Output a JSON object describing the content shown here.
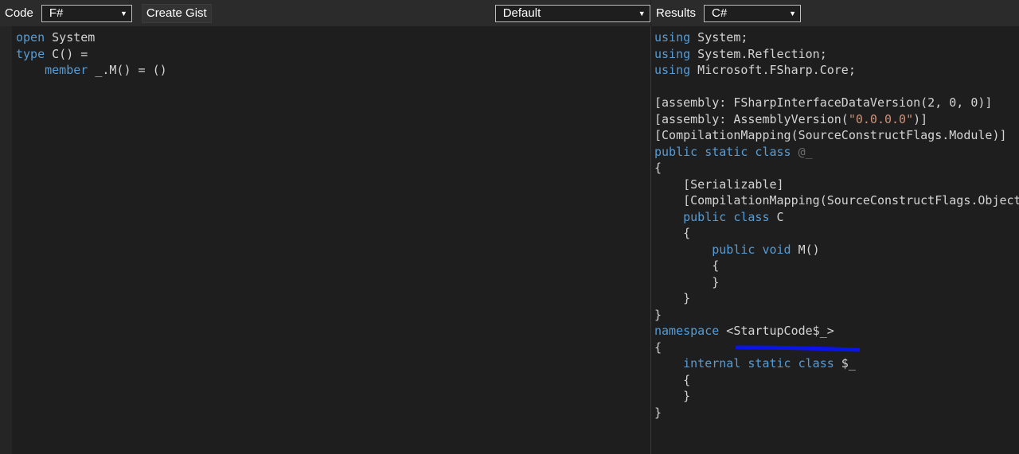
{
  "toolbar_left": {
    "code_label": "Code",
    "language_value": "F#",
    "create_gist_label": "Create Gist",
    "mode_value": "Default"
  },
  "toolbar_right": {
    "results_label": "Results",
    "output_language_value": "C#"
  },
  "colors": {
    "keyword": "#569cd6",
    "text": "#d4d4d4",
    "string": "#ce9178",
    "annotation": "#0a14e6"
  },
  "code_lines": [
    [
      {
        "k": "kw",
        "t": "open"
      },
      {
        "k": "tx",
        "t": " System"
      }
    ],
    [
      {
        "k": "kw",
        "t": "type"
      },
      {
        "k": "tx",
        "t": " C() ="
      }
    ],
    [
      {
        "k": "tx",
        "t": "    "
      },
      {
        "k": "kw",
        "t": "member"
      },
      {
        "k": "tx",
        "t": " _.M() = ()"
      }
    ]
  ],
  "result_lines": [
    [
      {
        "k": "kw",
        "t": "using"
      },
      {
        "k": "tx",
        "t": " System;"
      }
    ],
    [
      {
        "k": "kw",
        "t": "using"
      },
      {
        "k": "tx",
        "t": " System.Reflection;"
      }
    ],
    [
      {
        "k": "kw",
        "t": "using"
      },
      {
        "k": "tx",
        "t": " Microsoft.FSharp.Core;"
      }
    ],
    [],
    [
      {
        "k": "tx",
        "t": "[assembly: FSharpInterfaceDataVersion(2, 0, 0)]"
      }
    ],
    [
      {
        "k": "tx",
        "t": "[assembly: AssemblyVersion("
      },
      {
        "k": "str",
        "t": "\"0.0.0.0\""
      },
      {
        "k": "tx",
        "t": ")]"
      }
    ],
    [
      {
        "k": "tx",
        "t": "[CompilationMapping(SourceConstructFlags.Module)]"
      }
    ],
    [
      {
        "k": "kw",
        "t": "public static class"
      },
      {
        "k": "tx",
        "t": " "
      },
      {
        "k": "dim",
        "t": "@_"
      }
    ],
    [
      {
        "k": "tx",
        "t": "{"
      }
    ],
    [
      {
        "k": "tx",
        "t": "    [Serializable]"
      }
    ],
    [
      {
        "k": "tx",
        "t": "    [CompilationMapping(SourceConstructFlags.ObjectType)]"
      }
    ],
    [
      {
        "k": "tx",
        "t": "    "
      },
      {
        "k": "kw",
        "t": "public class"
      },
      {
        "k": "tx",
        "t": " C"
      }
    ],
    [
      {
        "k": "tx",
        "t": "    {"
      }
    ],
    [
      {
        "k": "tx",
        "t": "        "
      },
      {
        "k": "kw",
        "t": "public void"
      },
      {
        "k": "tx",
        "t": " M()"
      }
    ],
    [
      {
        "k": "tx",
        "t": "        {"
      }
    ],
    [
      {
        "k": "tx",
        "t": "        }"
      }
    ],
    [
      {
        "k": "tx",
        "t": "    }"
      }
    ],
    [
      {
        "k": "tx",
        "t": "}"
      }
    ],
    [
      {
        "k": "kw",
        "t": "namespace"
      },
      {
        "k": "tx",
        "t": " <StartupCode$_>"
      }
    ],
    [
      {
        "k": "tx",
        "t": "{"
      }
    ],
    [
      {
        "k": "tx",
        "t": "    "
      },
      {
        "k": "kw",
        "t": "internal static class"
      },
      {
        "k": "tx",
        "t": " $_"
      }
    ],
    [
      {
        "k": "tx",
        "t": "    {"
      }
    ],
    [
      {
        "k": "tx",
        "t": "    }"
      }
    ],
    [
      {
        "k": "tx",
        "t": "}"
      }
    ]
  ]
}
